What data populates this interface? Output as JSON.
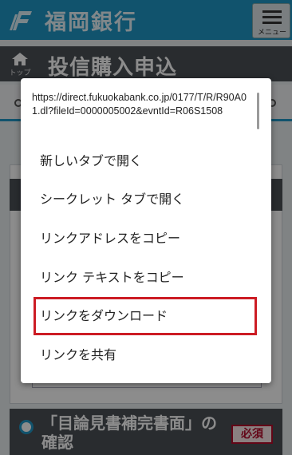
{
  "header": {
    "bank_name": "福岡銀行",
    "menu_label": "メニュー"
  },
  "title_bar": {
    "home_label": "トップ",
    "page_title": "投信購入申込"
  },
  "confirm": {
    "text": "「目論見書補完書面」の確認",
    "required_badge": "必須"
  },
  "context_menu": {
    "url": "https://direct.fukuokabank.co.jp/0177/T/R/R90A01.dl?fileId=0000005002&evntId=R06S1508",
    "items": [
      {
        "label": "新しいタブで開く"
      },
      {
        "label": "シークレット タブで開く"
      },
      {
        "label": "リンクアドレスをコピー"
      },
      {
        "label": "リンク テキストをコピー"
      },
      {
        "label": "リンクをダウンロード"
      },
      {
        "label": "リンクを共有"
      }
    ],
    "highlighted_item": "リンクをダウンロード"
  },
  "colors": {
    "brand": "#1f97c7",
    "highlight": "#cc1c24",
    "required": "#b50c2b"
  }
}
